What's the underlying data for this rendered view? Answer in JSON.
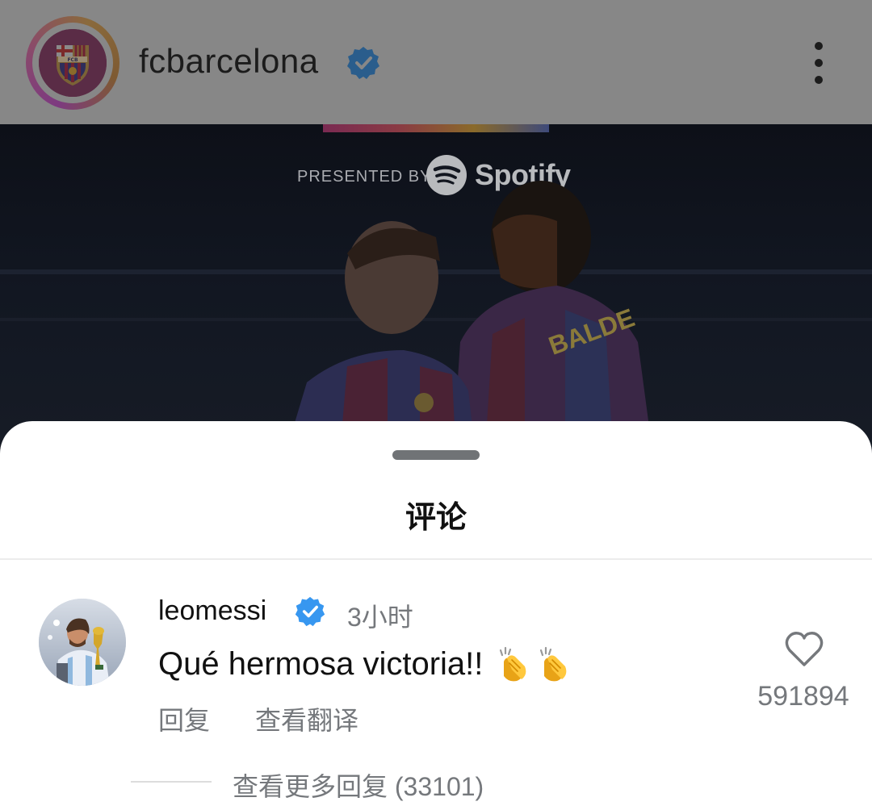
{
  "post": {
    "account": "fcbarcelona",
    "verified_icon": "verified-badge-icon",
    "logo_text": "FCB",
    "presented_by": "PRESENTED BY",
    "sponsor": "Spotify",
    "player_name": "BALDE",
    "colors": {
      "overlay": "#878787",
      "club_blue": "#1f3a8a",
      "club_red": "#a50044"
    }
  },
  "sheet": {
    "title": "评论"
  },
  "comment": {
    "user": "leomessi",
    "time": "3小时",
    "text": "Qué hermosa victoria!!",
    "emoji": [
      "clapping-hands-icon",
      "clapping-hands-icon"
    ],
    "reply_label": "回复",
    "translate_label": "查看翻译",
    "like_count": "591894",
    "view_more_replies": "查看更多回复 (33101)"
  },
  "colors": {
    "verified": "#3797f0",
    "secondary_text": "#75787c"
  }
}
